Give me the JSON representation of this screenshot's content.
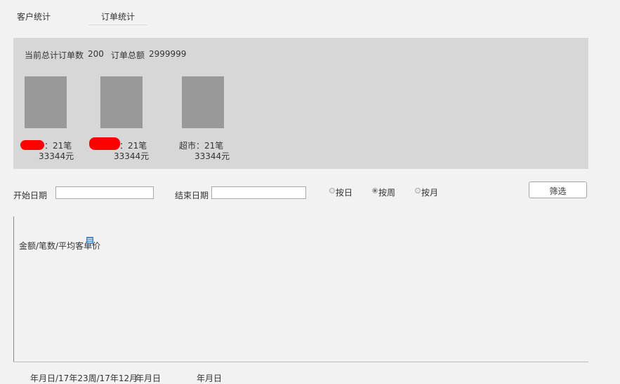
{
  "tabs": {
    "customer": "客户统计",
    "order": "订单统计"
  },
  "summary": {
    "total_orders_label": "当前总计订单数",
    "total_orders_value": "200",
    "total_amount_label": "订单总额",
    "total_amount_value": "2999999",
    "stores": [
      {
        "name": "",
        "count": "：21笔",
        "amount": "33344元",
        "redacted": true
      },
      {
        "name": "",
        "count": "：21笔",
        "amount": "33344元",
        "redacted": true
      },
      {
        "name": "超市",
        "count": "：21笔",
        "amount": "33344元",
        "redacted": false
      }
    ]
  },
  "filters": {
    "start_label": "开始日期",
    "start_value": "",
    "end_label": "结束日期",
    "end_value": "",
    "radios": [
      {
        "label": "按日",
        "checked": false
      },
      {
        "label": "按周",
        "checked": true
      },
      {
        "label": "按月",
        "checked": false
      }
    ],
    "filter_button": "筛选"
  },
  "chart": {
    "ylabel": "金额/笔数/平均客单价",
    "icon": "chart-legend-icon",
    "xticks": [
      "年月日/17年23周/17年12月",
      "年月日",
      "年月日"
    ]
  },
  "colors": {
    "panel": "#d7d7d7",
    "bar": "#999999",
    "redaction": "#ff0000",
    "background": "#f2f2f2"
  }
}
